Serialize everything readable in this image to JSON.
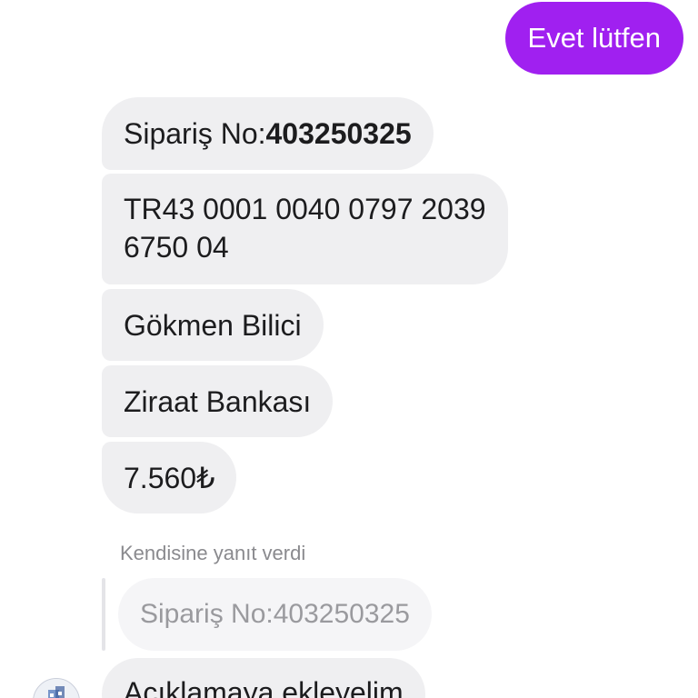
{
  "messages": {
    "outgoing": {
      "text": "Evet lütfen"
    },
    "incoming": [
      {
        "prefix": "Sipariş No:",
        "bold": "403250325"
      },
      {
        "line1": "TR43 0001 0040 0797 2039",
        "line2": "6750 04"
      },
      {
        "text": "Gökmen Bilici"
      },
      {
        "text": "Ziraat Bankası"
      },
      {
        "text": "7.560₺"
      }
    ],
    "reply": {
      "caption": "Kendisine yanıt verdi",
      "quoted": "Sipariş No:403250325",
      "text": "Açıklamaya ekleyelim"
    }
  },
  "colors": {
    "outgoing_bubble": "#a020f0",
    "incoming_bubble": "#efeff1"
  },
  "icons": {
    "avatar": "user-avatar-icon"
  }
}
